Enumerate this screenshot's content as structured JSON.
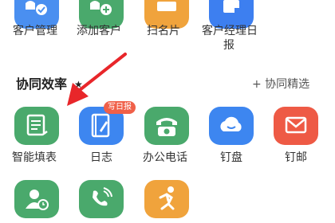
{
  "top_row": [
    {
      "label": "客户管理",
      "icon": "customer-check-icon",
      "color": "#4a8ff0"
    },
    {
      "label": "添加客户",
      "icon": "add-customer-icon",
      "color": "#4aa96c"
    },
    {
      "label": "扫名片",
      "icon": "scan-card-icon",
      "color": "#f0a33c"
    },
    {
      "label_line1": "客户经理日",
      "label_line2": "报",
      "icon": "manager-report-icon",
      "color": "#3d7ff0"
    }
  ],
  "section": {
    "title": "协同效率",
    "star": "★",
    "select_link": "+ 协同精选"
  },
  "apps": [
    {
      "label": "智能填表",
      "icon": "form-doc-icon",
      "color": "#4aa96c"
    },
    {
      "label": "日志",
      "icon": "log-book-icon",
      "color": "#3d86f0",
      "badge": "写日报"
    },
    {
      "label": "办公电话",
      "icon": "office-phone-icon",
      "color": "#4aa96c"
    },
    {
      "label": "钉盘",
      "icon": "cloud-drive-icon",
      "color": "#3d86f0"
    },
    {
      "label": "钉邮",
      "icon": "mail-icon",
      "color": "#ee5a45"
    }
  ],
  "bottom_row": [
    {
      "icon": "contact-clock-icon",
      "color": "#4aa96c"
    },
    {
      "icon": "video-call-icon",
      "color": "#4aa96c"
    },
    {
      "icon": "running-man-icon",
      "color": "#f0a33c"
    }
  ],
  "annotation": {
    "icon": "red-arrow-icon",
    "color": "#e8262a"
  }
}
